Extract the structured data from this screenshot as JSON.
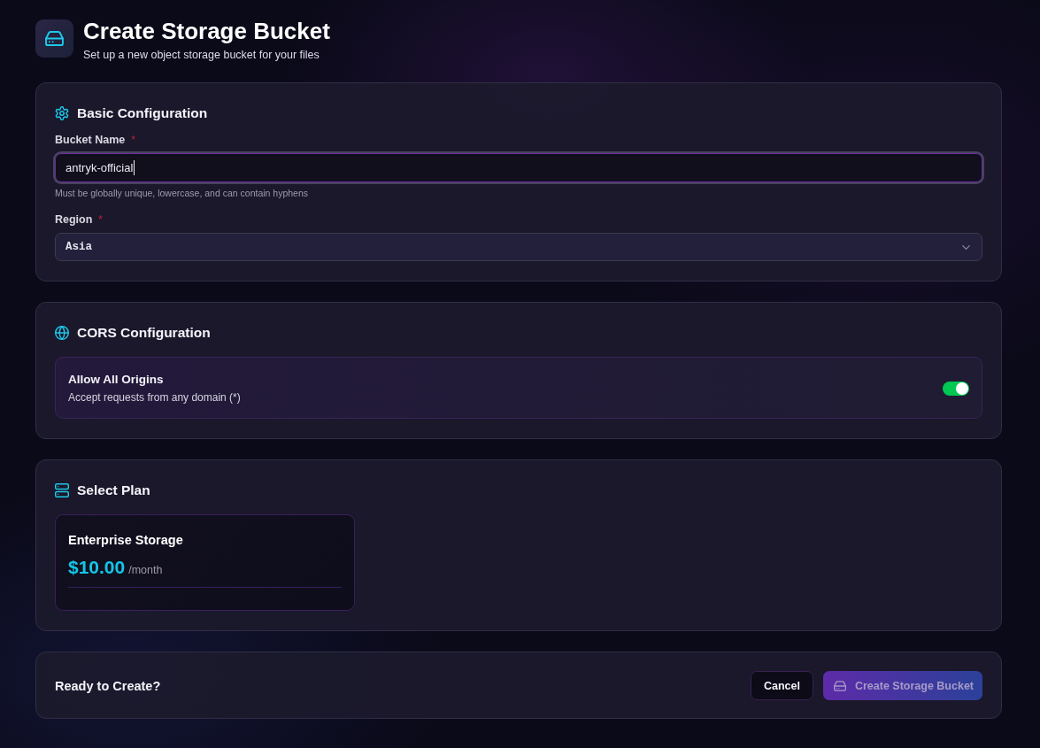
{
  "header": {
    "title": "Create Storage Bucket",
    "subtitle": "Set up a new object storage bucket for your files"
  },
  "basic_configuration": {
    "heading": "Basic Configuration",
    "bucket_name": {
      "label": "Bucket Name",
      "required_mark": "*",
      "value": "antryk-official",
      "focused": true,
      "help_text": "Must be globally unique, lowercase, and can contain hyphens"
    },
    "region": {
      "label": "Region",
      "required_mark": "*",
      "value": "Asia"
    }
  },
  "cors_configuration": {
    "heading": "CORS Configuration",
    "allow_all_origins": {
      "title": "Allow All Origins",
      "description": "Accept requests from any domain (*)",
      "on": true
    }
  },
  "select_plan": {
    "heading": "Select Plan",
    "plans": [
      {
        "name": "Enterprise Storage",
        "price": "$10.00",
        "period": "/month",
        "selected": false
      }
    ]
  },
  "footer": {
    "prompt": "Ready to Create?",
    "buttons": [
      {
        "kind": "secondary",
        "label": "Cancel",
        "disabled": false
      },
      {
        "kind": "primary",
        "label": "Create Storage Bucket",
        "disabled": true
      }
    ]
  }
}
